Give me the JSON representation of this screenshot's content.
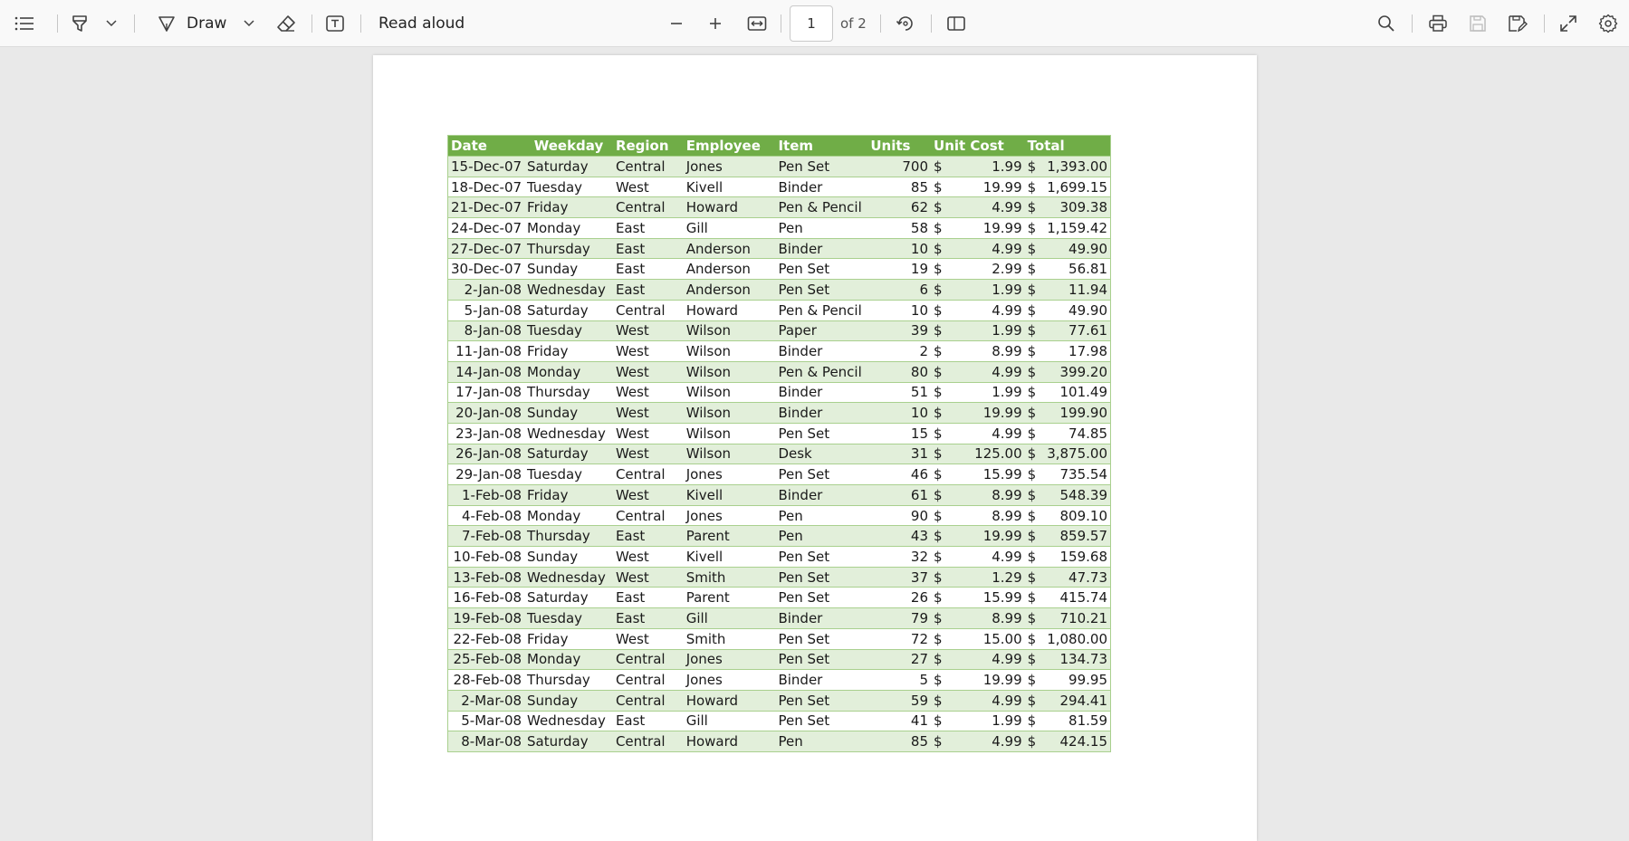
{
  "toolbar": {
    "draw_label": "Draw",
    "read_aloud_label": "Read aloud",
    "page_number": "1",
    "page_total": "of 2"
  },
  "table": {
    "headers": [
      "Date",
      "Weekday",
      "Region",
      "Employee",
      "Item",
      "Units",
      "Unit Cost",
      "Total"
    ],
    "currency_symbol": "$",
    "rows": [
      [
        "15-Dec-07",
        "Saturday",
        "Central",
        "Jones",
        "Pen Set",
        "700",
        "1.99",
        "1,393.00"
      ],
      [
        "18-Dec-07",
        "Tuesday",
        "West",
        "Kivell",
        "Binder",
        "85",
        "19.99",
        "1,699.15"
      ],
      [
        "21-Dec-07",
        "Friday",
        "Central",
        "Howard",
        "Pen & Pencil",
        "62",
        "4.99",
        "309.38"
      ],
      [
        "24-Dec-07",
        "Monday",
        "East",
        "Gill",
        "Pen",
        "58",
        "19.99",
        "1,159.42"
      ],
      [
        "27-Dec-07",
        "Thursday",
        "East",
        "Anderson",
        "Binder",
        "10",
        "4.99",
        "49.90"
      ],
      [
        "30-Dec-07",
        "Sunday",
        "East",
        "Anderson",
        "Pen Set",
        "19",
        "2.99",
        "56.81"
      ],
      [
        "2-Jan-08",
        "Wednesday",
        "East",
        "Anderson",
        "Pen Set",
        "6",
        "1.99",
        "11.94"
      ],
      [
        "5-Jan-08",
        "Saturday",
        "Central",
        "Howard",
        "Pen & Pencil",
        "10",
        "4.99",
        "49.90"
      ],
      [
        "8-Jan-08",
        "Tuesday",
        "West",
        "Wilson",
        "Paper",
        "39",
        "1.99",
        "77.61"
      ],
      [
        "11-Jan-08",
        "Friday",
        "West",
        "Wilson",
        "Binder",
        "2",
        "8.99",
        "17.98"
      ],
      [
        "14-Jan-08",
        "Monday",
        "West",
        "Wilson",
        "Pen & Pencil",
        "80",
        "4.99",
        "399.20"
      ],
      [
        "17-Jan-08",
        "Thursday",
        "West",
        "Wilson",
        "Binder",
        "51",
        "1.99",
        "101.49"
      ],
      [
        "20-Jan-08",
        "Sunday",
        "West",
        "Wilson",
        "Binder",
        "10",
        "19.99",
        "199.90"
      ],
      [
        "23-Jan-08",
        "Wednesday",
        "West",
        "Wilson",
        "Pen Set",
        "15",
        "4.99",
        "74.85"
      ],
      [
        "26-Jan-08",
        "Saturday",
        "West",
        "Wilson",
        "Desk",
        "31",
        "125.00",
        "3,875.00"
      ],
      [
        "29-Jan-08",
        "Tuesday",
        "Central",
        "Jones",
        "Pen Set",
        "46",
        "15.99",
        "735.54"
      ],
      [
        "1-Feb-08",
        "Friday",
        "West",
        "Kivell",
        "Binder",
        "61",
        "8.99",
        "548.39"
      ],
      [
        "4-Feb-08",
        "Monday",
        "Central",
        "Jones",
        "Pen",
        "90",
        "8.99",
        "809.10"
      ],
      [
        "7-Feb-08",
        "Thursday",
        "East",
        "Parent",
        "Pen",
        "43",
        "19.99",
        "859.57"
      ],
      [
        "10-Feb-08",
        "Sunday",
        "West",
        "Kivell",
        "Pen Set",
        "32",
        "4.99",
        "159.68"
      ],
      [
        "13-Feb-08",
        "Wednesday",
        "West",
        "Smith",
        "Pen Set",
        "37",
        "1.29",
        "47.73"
      ],
      [
        "16-Feb-08",
        "Saturday",
        "East",
        "Parent",
        "Pen Set",
        "26",
        "15.99",
        "415.74"
      ],
      [
        "19-Feb-08",
        "Tuesday",
        "East",
        "Gill",
        "Binder",
        "79",
        "8.99",
        "710.21"
      ],
      [
        "22-Feb-08",
        "Friday",
        "West",
        "Smith",
        "Pen Set",
        "72",
        "15.00",
        "1,080.00"
      ],
      [
        "25-Feb-08",
        "Monday",
        "Central",
        "Jones",
        "Pen Set",
        "27",
        "4.99",
        "134.73"
      ],
      [
        "28-Feb-08",
        "Thursday",
        "Central",
        "Jones",
        "Binder",
        "5",
        "19.99",
        "99.95"
      ],
      [
        "2-Mar-08",
        "Sunday",
        "Central",
        "Howard",
        "Pen Set",
        "59",
        "4.99",
        "294.41"
      ],
      [
        "5-Mar-08",
        "Wednesday",
        "East",
        "Gill",
        "Pen Set",
        "41",
        "1.99",
        "81.59"
      ],
      [
        "8-Mar-08",
        "Saturday",
        "Central",
        "Howard",
        "Pen",
        "85",
        "4.99",
        "424.15"
      ]
    ]
  }
}
